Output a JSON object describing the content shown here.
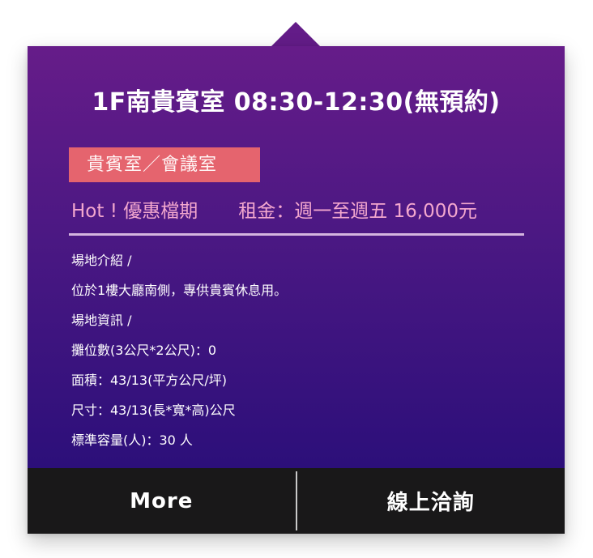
{
  "popup": {
    "title": "1F南貴賓室  08:30-12:30(無預約)",
    "category": "貴賓室／會議室",
    "promo_label": "Hot ! 優惠檔期",
    "rent_text": "租金：週一至週五 16,000元",
    "details": [
      "場地介紹 /",
      "位於1樓大廳南側，專供貴賓休息用。",
      "場地資訊 /",
      "攤位數(3公尺*2公尺)：0",
      "面積：43/13(平方公尺/坪)",
      "尺寸：43/13(長*寬*高)公尺",
      "標準容量(人)：30 人"
    ]
  },
  "footer": {
    "more_label": "More",
    "inquiry_label": "線上洽詢"
  },
  "colors": {
    "gradient_top": "#661c89",
    "gradient_bottom": "#2c0f7a",
    "category_bg": "#e5646e",
    "promo_text": "#f3a7ce",
    "footer_bg": "#191819"
  }
}
